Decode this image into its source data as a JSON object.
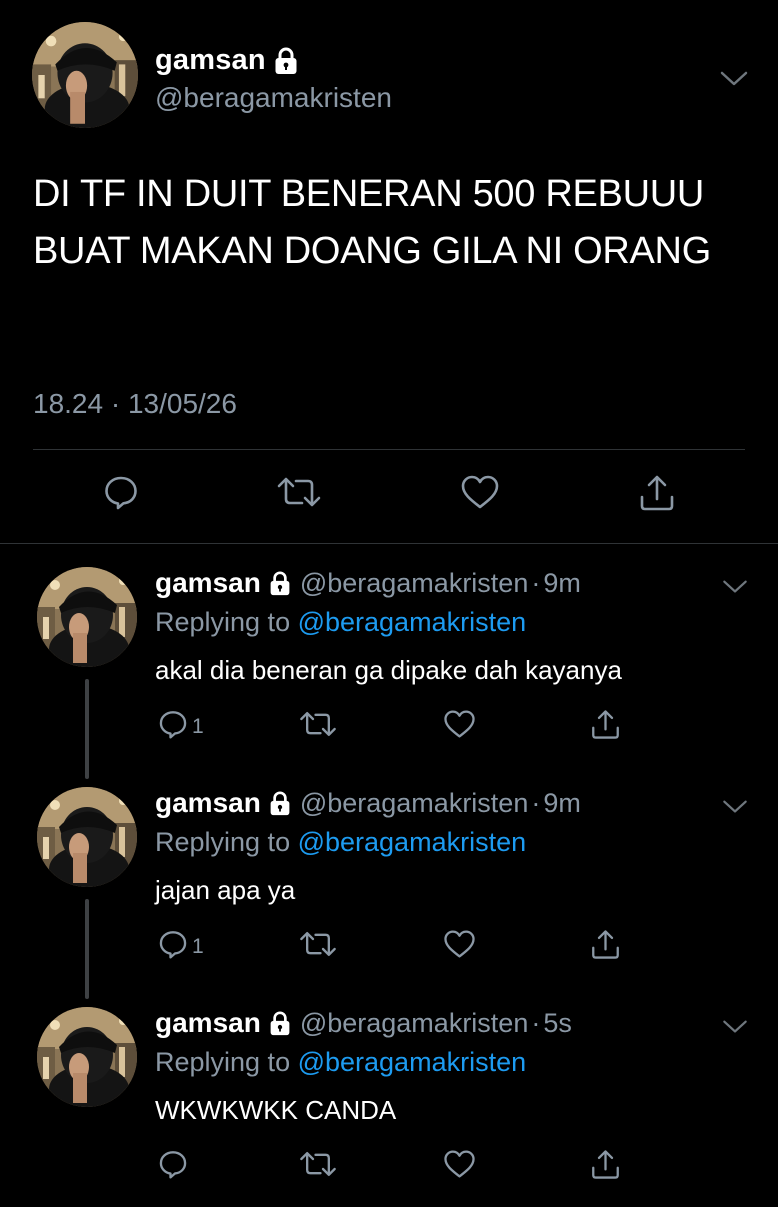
{
  "main_tweet": {
    "display_name": "gamsan",
    "handle": "@beragamakristen",
    "protected_icon": "lock-icon",
    "text": "DI TF IN DUIT BENERAN 500 REBUUU BUAT MAKAN DOANG GILA NI ORANG",
    "timestamp": "18.24 · 13/05/26",
    "actions": [
      "reply-icon",
      "retweet-icon",
      "like-icon",
      "share-icon"
    ]
  },
  "replies": [
    {
      "display_name": "gamsan",
      "handle": "@beragamakristen",
      "separator": "·",
      "time": "9m",
      "replying_prefix": "Replying to ",
      "replying_to": "@beragamakristen",
      "text": "akal dia beneran ga dipake dah kayanya",
      "reply_count": "1"
    },
    {
      "display_name": "gamsan",
      "handle": "@beragamakristen",
      "separator": "·",
      "time": "9m",
      "replying_prefix": "Replying to ",
      "replying_to": "@beragamakristen",
      "text": "jajan apa ya",
      "reply_count": "1"
    },
    {
      "display_name": "gamsan",
      "handle": "@beragamakristen",
      "separator": "·",
      "time": "5s",
      "replying_prefix": "Replying to ",
      "replying_to": "@beragamakristen",
      "text": "WKWKWKK CANDA",
      "reply_count": ""
    }
  ],
  "colors": {
    "background": "#000000",
    "text_primary": "#ffffff",
    "text_secondary": "#8b98a5",
    "link": "#1d9bf0",
    "divider": "#2f3336"
  }
}
